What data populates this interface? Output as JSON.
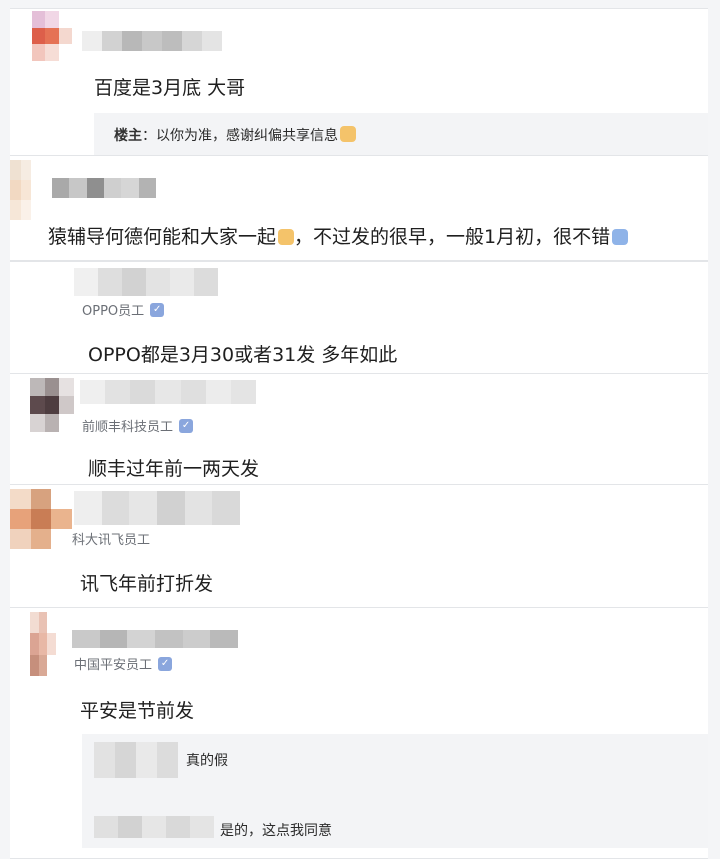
{
  "comments": [
    {
      "content": "百度是3月底 大哥",
      "reply": {
        "author": "楼主",
        "separator": "：",
        "text": "以你为准，感谢纠偏共享信息",
        "emoji": "smile-emoji"
      }
    },
    {
      "content_parts": [
        "猿辅导何德何能和大家一起",
        "，不过发的很早，一般1月初，很不错"
      ],
      "emoji": [
        "smile-emoji",
        "grin-emoji"
      ]
    },
    {
      "badge": "OPPO员工",
      "content": "OPPO都是3月30或者31发 多年如此"
    },
    {
      "badge": "前顺丰科技员工",
      "content": "顺丰过年前一两天发"
    },
    {
      "badge": "科大讯飞员工",
      "content": "讯飞年前打折发"
    },
    {
      "badge": "中国平安员工",
      "content": "平安是节前发",
      "replies": [
        {
          "text": "真的假"
        },
        {
          "text": "是的，这点我同意"
        }
      ]
    }
  ],
  "colors": {
    "page_bg": "#f4f5f7",
    "card_bg": "#ffffff",
    "reply_bg": "#f3f4f6",
    "verify_badge": "#8aa6dd",
    "emoji": "#f4c36a"
  }
}
